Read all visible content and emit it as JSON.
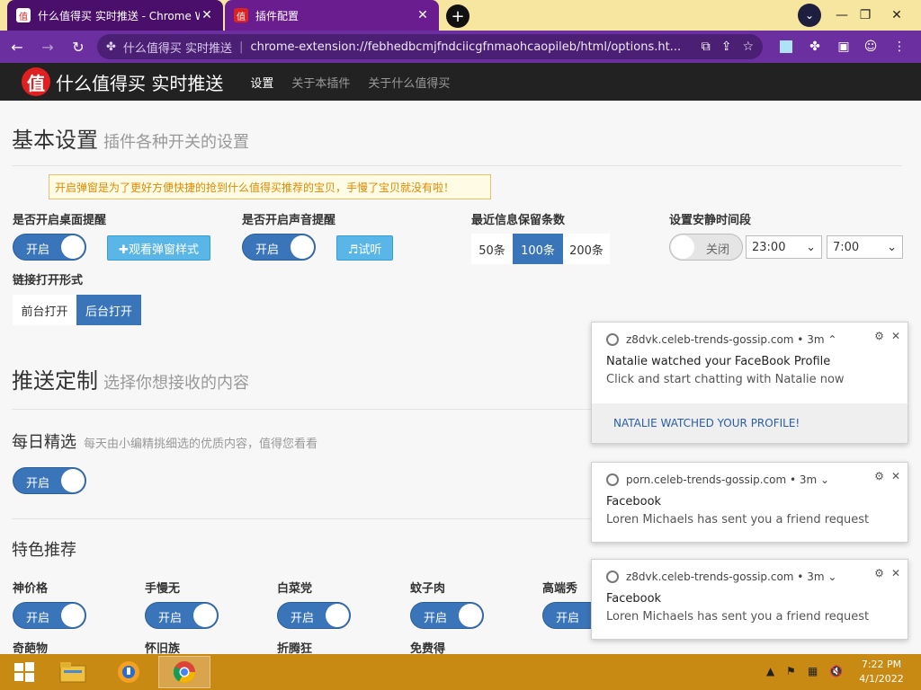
{
  "browser": {
    "tabs": [
      {
        "title": "什么值得买 实时推送 - Chrome W",
        "icon": "zdm-favicon",
        "close": "✕"
      },
      {
        "title": "插件配置",
        "icon": "zdm-favicon",
        "close": "✕"
      }
    ],
    "new_tab": "+",
    "window_controls": {
      "minimize": "—",
      "restore": "❐",
      "close": "✕"
    },
    "omnibox": {
      "site_name": "什么值得买 实时推送",
      "separator": "|",
      "url": "chrome-extension://febhedbcmjfndciicgfnmaohcaopileb/html/options.ht..."
    }
  },
  "site": {
    "logo_char": "值",
    "brand": "什么值得买 实时推送",
    "nav": [
      "设置",
      "关于本插件",
      "关于什么值得买"
    ]
  },
  "basic": {
    "title": "基本设置",
    "subtitle": "插件各种开关的设置",
    "tooltip": "开启弹窗是为了更好方便快捷的抢到什么值得买推荐的宝贝，手慢了宝贝就没有啦！",
    "desktop_label": "是否开启桌面提醒",
    "desktop_toggle": "开启",
    "watch_popup_btn": "✚观看弹窗样式",
    "sound_label": "是否开启声音提醒",
    "sound_toggle": "开启",
    "listen_btn": "♬试听",
    "keep_label": "最近信息保留条数",
    "keep_options": [
      "50条",
      "100条",
      "200条"
    ],
    "quiet_label": "设置安静时间段",
    "quiet_toggle": "关闭",
    "quiet_from": "23:00",
    "quiet_to": "7:00",
    "link_label": "链接打开形式",
    "link_options": [
      "前台打开",
      "后台打开"
    ]
  },
  "push": {
    "title": "推送定制",
    "subtitle": "选择你想接收的内容",
    "daily_title": "每日精选",
    "daily_sub": "每天由小编精挑细选的优质内容，值得您看看",
    "daily_toggle": "开启",
    "featured_title": "特色推荐",
    "items": [
      {
        "label": "神价格",
        "toggle": "开启"
      },
      {
        "label": "手慢无",
        "toggle": "开启"
      },
      {
        "label": "白菜党",
        "toggle": "开启"
      },
      {
        "label": "蚊子肉",
        "toggle": "开启"
      },
      {
        "label": "高端秀",
        "toggle": "开启"
      }
    ],
    "items_row2": [
      "奇葩物",
      "怀旧族",
      "折腾狂",
      "免费得"
    ]
  },
  "notifications": [
    {
      "source": "z8dvk.celeb-trends-gossip.com",
      "time": "3m",
      "chev": "⌃",
      "title": "Natalie watched your FaceBook Profile",
      "body": "Click and start chatting with Natalie now",
      "action": "NATALIE WATCHED YOUR PROFILE!"
    },
    {
      "source": "porn.celeb-trends-gossip.com",
      "time": "3m",
      "chev": "⌄",
      "title": "Facebook",
      "body": "Loren Michaels has sent you a friend request"
    },
    {
      "source": "z8dvk.celeb-trends-gossip.com",
      "time": "3m",
      "chev": "⌄",
      "title": "Facebook",
      "body": "Loren Michaels has sent you a friend request"
    }
  ],
  "taskbar": {
    "time": "7:22 PM",
    "date": "4/1/2022"
  },
  "colors": {
    "tab_strip": "#f7e6a0",
    "toolbar": "#6b2fa0",
    "accent": "#3a74b9",
    "taskbar": "#c98a14"
  }
}
